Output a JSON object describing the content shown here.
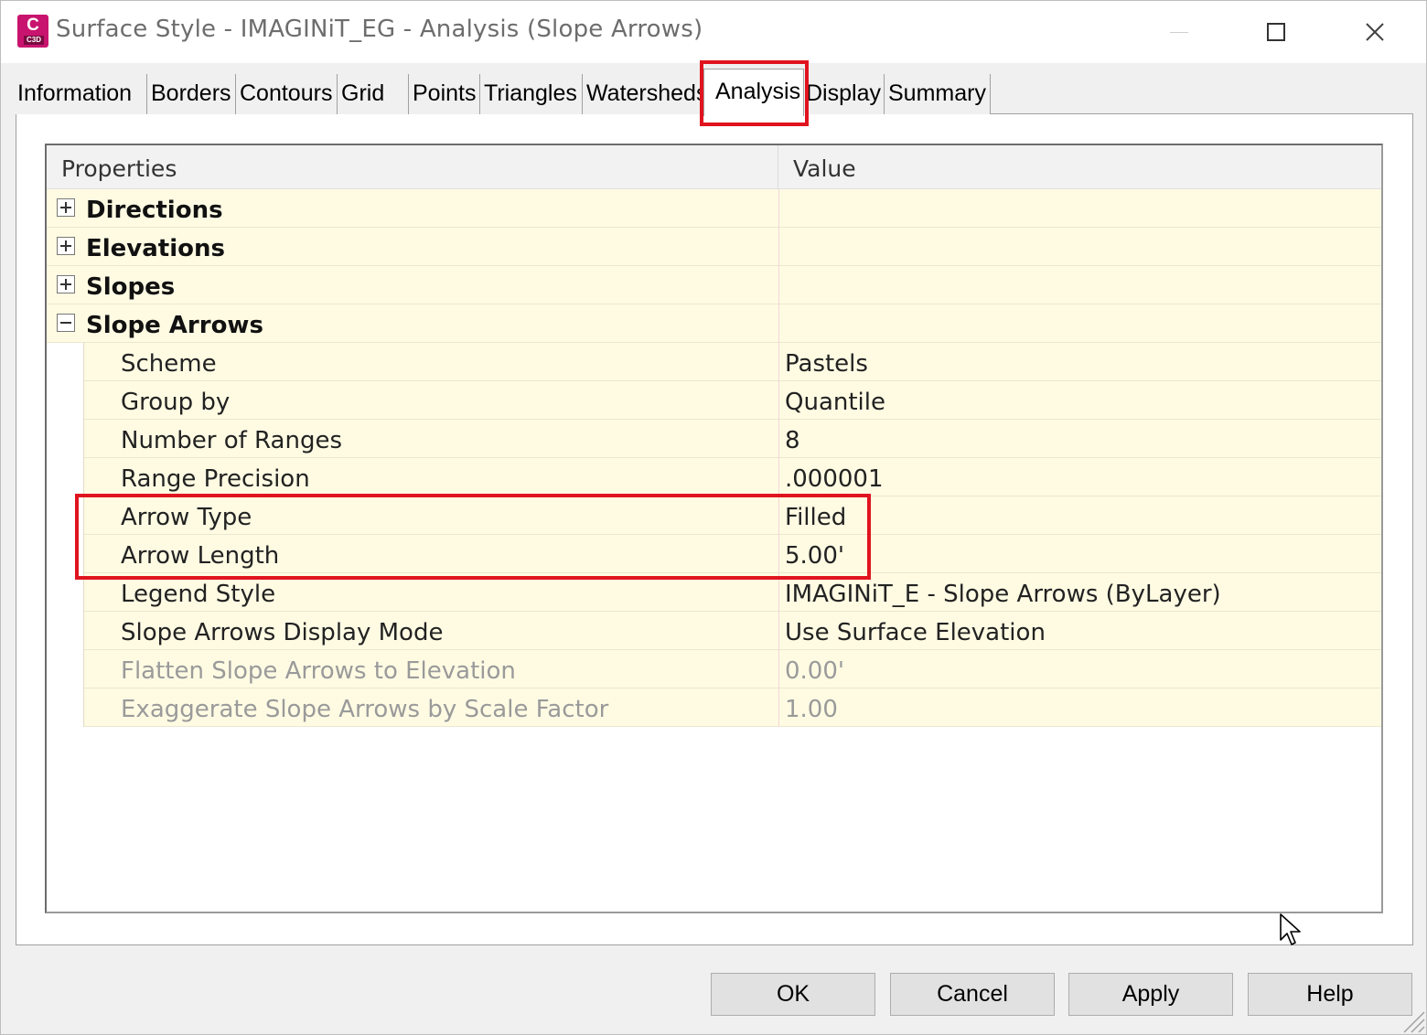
{
  "window": {
    "title": "Surface Style - IMAGINiT_EG - Analysis (Slope Arrows)",
    "app_icon_letter": "C",
    "app_icon_sub": "C3D",
    "icons": [
      "minimize-icon",
      "maximize-icon",
      "close-icon"
    ]
  },
  "tabs": [
    {
      "label": "Information"
    },
    {
      "label": "Borders"
    },
    {
      "label": "Contours"
    },
    {
      "label": "Grid"
    },
    {
      "label": "Points"
    },
    {
      "label": "Triangles"
    },
    {
      "label": "Watersheds"
    },
    {
      "label": "Analysis",
      "active": true
    },
    {
      "label": "Display"
    },
    {
      "label": "Summary"
    }
  ],
  "grid": {
    "header_properties": "Properties",
    "header_value": "Value",
    "categories": {
      "directions": "Directions",
      "elevations": "Elevations",
      "slopes": "Slopes",
      "slope_arrows": "Slope Arrows"
    },
    "slope_arrows_props": [
      {
        "name": "Scheme",
        "value": "Pastels"
      },
      {
        "name": "Group by",
        "value": "Quantile"
      },
      {
        "name": "Number of Ranges",
        "value": "8"
      },
      {
        "name": "Range Precision",
        "value": ".000001"
      },
      {
        "name": "Arrow Type",
        "value": "Filled"
      },
      {
        "name": "Arrow Length",
        "value": "5.00'"
      },
      {
        "name": "Legend Style",
        "value": "IMAGINiT_E - Slope Arrows (ByLayer)"
      },
      {
        "name": "Slope Arrows Display Mode",
        "value": "Use Surface Elevation"
      },
      {
        "name": "Flatten Slope Arrows to Elevation",
        "value": "0.00'",
        "disabled": true
      },
      {
        "name": "Exaggerate Slope Arrows by Scale Factor",
        "value": "1.00",
        "disabled": true
      }
    ]
  },
  "buttons": {
    "ok": "OK",
    "cancel": "Cancel",
    "apply": "Apply",
    "help": "Help"
  },
  "colors": {
    "highlight": "#e0141e",
    "row_background": "#fffbe3",
    "app_icon": "#c8146e"
  }
}
